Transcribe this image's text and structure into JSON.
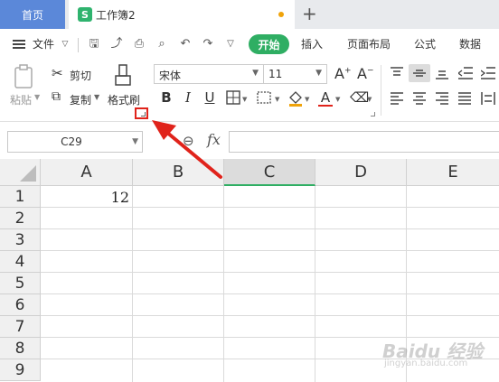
{
  "tabs": {
    "home": "首页",
    "doc_title": "工作簿2",
    "doc_icon": "S",
    "new_tab": "+"
  },
  "menu": {
    "file": "文件",
    "start": "开始",
    "insert": "插入",
    "page_layout": "页面布局",
    "formula": "公式",
    "data": "数据"
  },
  "ribbon": {
    "paste": "粘贴",
    "cut": "剪切",
    "copy": "复制",
    "format_painter": "格式刷",
    "font_name": "宋体",
    "font_size": "11",
    "bold": "B",
    "italic": "I",
    "underline": "U",
    "font_color_glyph": "A"
  },
  "formula_bar": {
    "cell_ref": "C29",
    "fx": "fx",
    "value": ""
  },
  "grid": {
    "columns": [
      "A",
      "B",
      "C",
      "D",
      "E"
    ],
    "active_column": "C",
    "rows": [
      "1",
      "2",
      "3",
      "4",
      "5",
      "6",
      "7",
      "8",
      "9"
    ],
    "cells": {
      "A1": "12"
    }
  },
  "watermark": {
    "brand": "Baidu 经验",
    "sub": "jingyan.baidu.com"
  },
  "colors": {
    "accent": "#2fae63",
    "home_tab": "#5b88d9",
    "annotation": "#e0231b"
  }
}
